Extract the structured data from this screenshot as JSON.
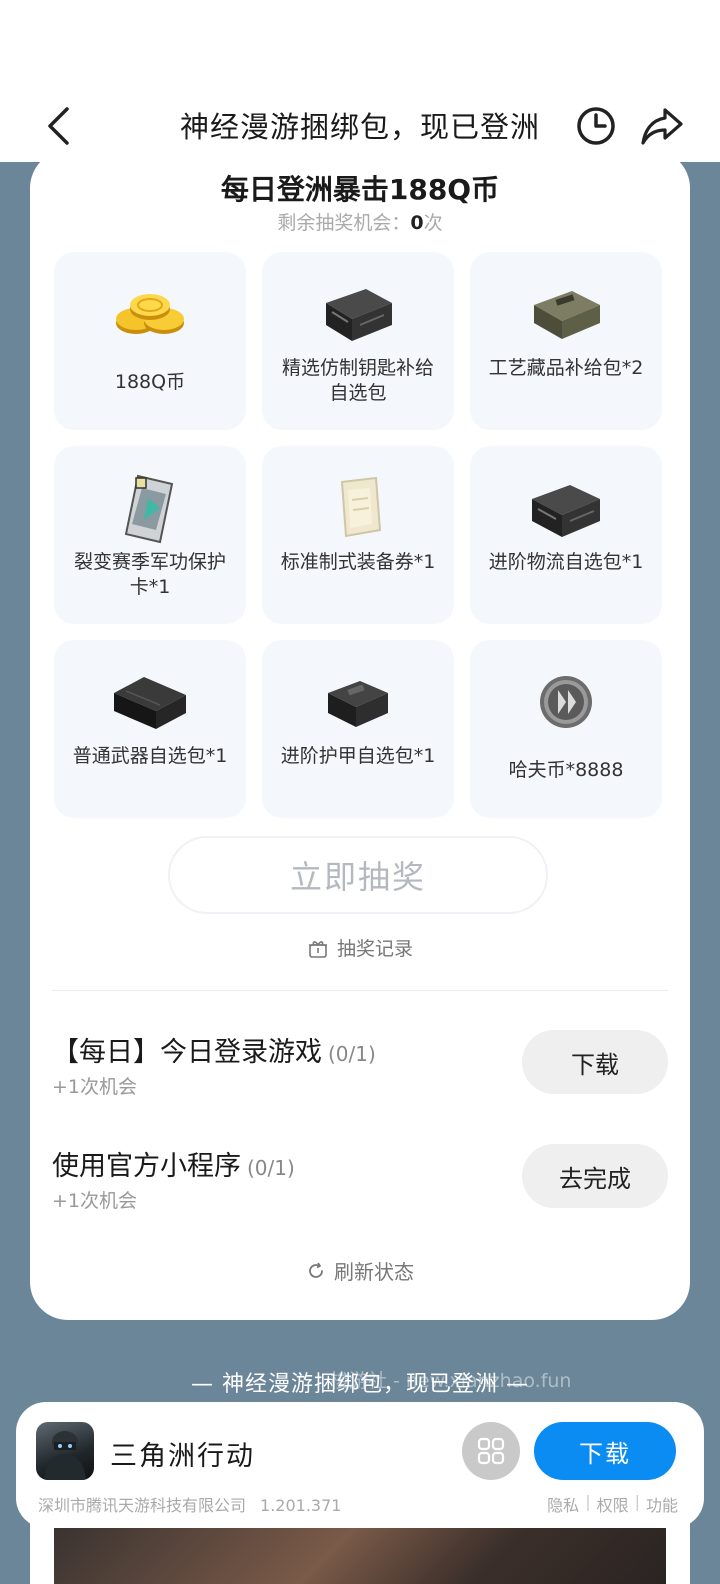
{
  "header": {
    "title": "神经漫游捆绑包，现已登洲"
  },
  "lottery": {
    "title": "每日登洲暴击188Q币",
    "chances_prefix": "剩余抽奖机会：",
    "chances_count": "0",
    "chances_suffix": "次",
    "prizes": [
      {
        "name": "188Q币",
        "icon": "gold-coins"
      },
      {
        "name": "精选仿制钥匙补给自选包",
        "icon": "black-crate"
      },
      {
        "name": "工艺藏品补给包*2",
        "icon": "olive-crate"
      },
      {
        "name": "裂变赛季军功保护卡*1",
        "icon": "card"
      },
      {
        "name": "标准制式装备券*1",
        "icon": "ticket"
      },
      {
        "name": "进阶物流自选包*1",
        "icon": "black-crate"
      },
      {
        "name": "普通武器自选包*1",
        "icon": "weapon-case"
      },
      {
        "name": "进阶护甲自选包*1",
        "icon": "armor-crate"
      },
      {
        "name": "哈夫币*8888",
        "icon": "silver-coin"
      }
    ],
    "draw_button": "立即抽奖",
    "record_label": "抽奖记录"
  },
  "tasks": [
    {
      "title": "【每日】今日登录游戏",
      "progress": "(0/1)",
      "reward": "+1次机会",
      "button": "下载"
    },
    {
      "title": "使用官方小程序",
      "progress": "(0/1)",
      "reward": "+1次机会",
      "button": "去完成"
    }
  ],
  "refresh_label": "刷新状态",
  "slogan": "— 神经漫游捆绑包，现已登洲 —",
  "watermark": "梭游社 - new.xianzhao.fun",
  "app": {
    "name": "三角洲行动",
    "download": "下载",
    "company": "深圳市腾讯天游科技有限公司",
    "version": "1.201.371",
    "links": [
      "隐私",
      "权限",
      "功能"
    ]
  },
  "colors": {
    "page_bg": "#6b8698",
    "accent_blue": "#0a8cf2",
    "prize_bg": "#f4f7fc"
  }
}
